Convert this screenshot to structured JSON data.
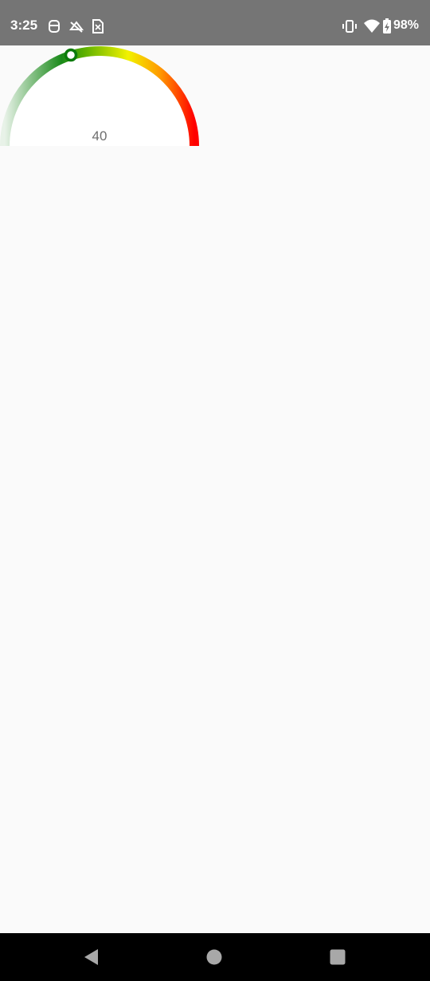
{
  "status_bar": {
    "time": "3:25",
    "battery_percent": "98%",
    "icons": [
      "robot-icon",
      "notification-off-icon",
      "sim-card-icon",
      "vibrate-icon",
      "wifi-icon",
      "battery-charging-icon"
    ]
  },
  "gauge": {
    "value_label": "40",
    "value": 40,
    "colors": {
      "start": "#e8f2e8",
      "mid_low": "#1a8a1a",
      "mid_high": "#f2f200",
      "end": "#ff0000",
      "thumb": "#0b7a0b"
    }
  },
  "nav_bar": {
    "buttons": [
      "back-icon",
      "home-icon",
      "recents-icon"
    ]
  }
}
